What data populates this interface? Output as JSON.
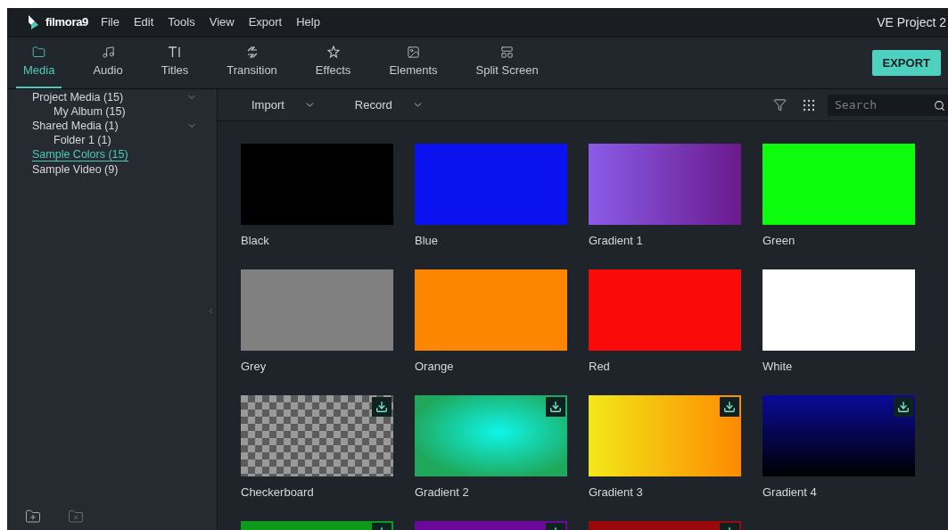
{
  "menu_bar": {
    "logo": "filmora9",
    "items": [
      "File",
      "Edit",
      "Tools",
      "View",
      "Export",
      "Help"
    ],
    "project_title": "VE Project 2"
  },
  "toolbar": {
    "tabs": [
      {
        "label": "Media",
        "selected": true
      },
      {
        "label": "Audio",
        "selected": false
      },
      {
        "label": "Titles",
        "selected": false
      },
      {
        "label": "Transition",
        "selected": false
      },
      {
        "label": "Effects",
        "selected": false
      },
      {
        "label": "Elements",
        "selected": false
      },
      {
        "label": "Split Screen",
        "selected": false
      }
    ],
    "export_button": "EXPORT"
  },
  "sidebar": {
    "items": [
      {
        "label": "Project Media (15)",
        "expanded": true,
        "selected": false,
        "children": [
          {
            "label": "My Album (15)",
            "selected": false
          }
        ]
      },
      {
        "label": "Shared Media (1)",
        "expanded": true,
        "selected": false,
        "children": [
          {
            "label": "Folder 1 (1)",
            "selected": false
          }
        ]
      },
      {
        "label": "Sample Colors (15)",
        "selected": true
      },
      {
        "label": "Sample Video (9)",
        "selected": false
      }
    ]
  },
  "media_header": {
    "dropdowns": [
      "Import",
      "Record"
    ],
    "search": {
      "placeholder": "Search"
    }
  },
  "tiles": [
    {
      "label": "Black",
      "kind": "solid",
      "color": "#000000",
      "downloadable": false
    },
    {
      "label": "Blue",
      "kind": "solid",
      "color": "#0a12f0",
      "downloadable": false
    },
    {
      "label": "Gradient 1",
      "kind": "violet",
      "downloadable": false
    },
    {
      "label": "Green",
      "kind": "solid",
      "color": "#0dfb0d",
      "downloadable": false
    },
    {
      "label": "Grey",
      "kind": "solid",
      "color": "#808080",
      "downloadable": false
    },
    {
      "label": "Orange",
      "kind": "solid",
      "color": "#fd8600",
      "downloadable": false
    },
    {
      "label": "Red",
      "kind": "solid",
      "color": "#fb0a0a",
      "downloadable": false
    },
    {
      "label": "White",
      "kind": "solid",
      "color": "#ffffff",
      "downloadable": false
    },
    {
      "label": "Checkerboard",
      "kind": "checker",
      "downloadable": true
    },
    {
      "label": "Gradient 2",
      "kind": "aqua",
      "downloadable": true
    },
    {
      "label": "Gradient 3",
      "kind": "sunset",
      "downloadable": true
    },
    {
      "label": "Gradient 4",
      "kind": "midnight",
      "downloadable": true
    },
    {
      "kind": "solid",
      "color": "#0e9a1a",
      "downloadable": true
    },
    {
      "kind": "solid",
      "color": "#6a0a9a",
      "downloadable": true
    },
    {
      "kind": "solid",
      "color": "#9a0a0a",
      "downloadable": true
    }
  ]
}
